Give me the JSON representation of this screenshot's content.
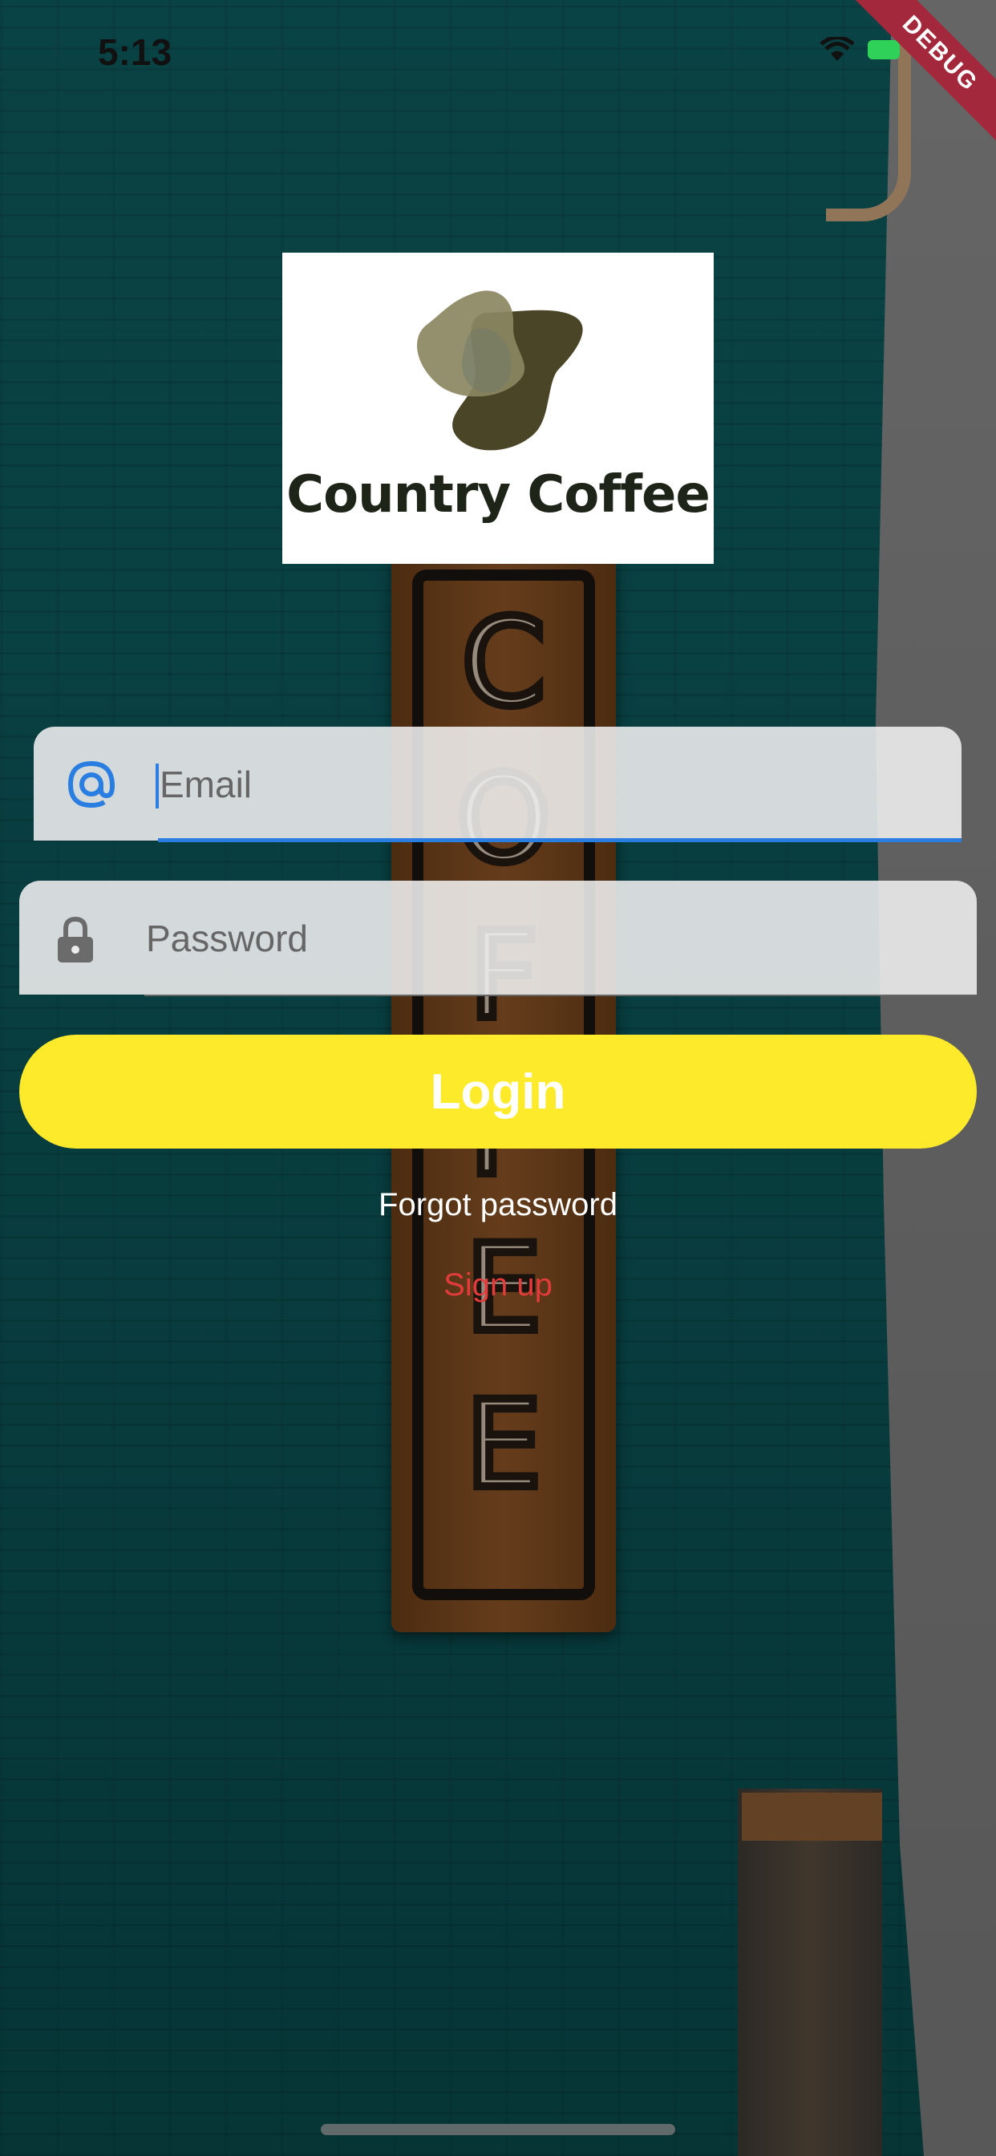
{
  "status_bar": {
    "time": "5:13"
  },
  "debug_banner": "DEBUG",
  "logo": {
    "text": "Country Coffee"
  },
  "background_sign": {
    "letters": [
      "C",
      "O",
      "F",
      "F",
      "E",
      "E"
    ]
  },
  "form": {
    "email_placeholder": "Email",
    "password_placeholder": "Password",
    "login_label": "Login",
    "forgot_password_label": "Forgot password",
    "signup_label": "Sign up"
  },
  "colors": {
    "accent_blue": "#2a7de1",
    "login_yellow": "#fdea2a",
    "signup_red": "#e23b3b",
    "wall_teal": "#0e5a5c"
  }
}
